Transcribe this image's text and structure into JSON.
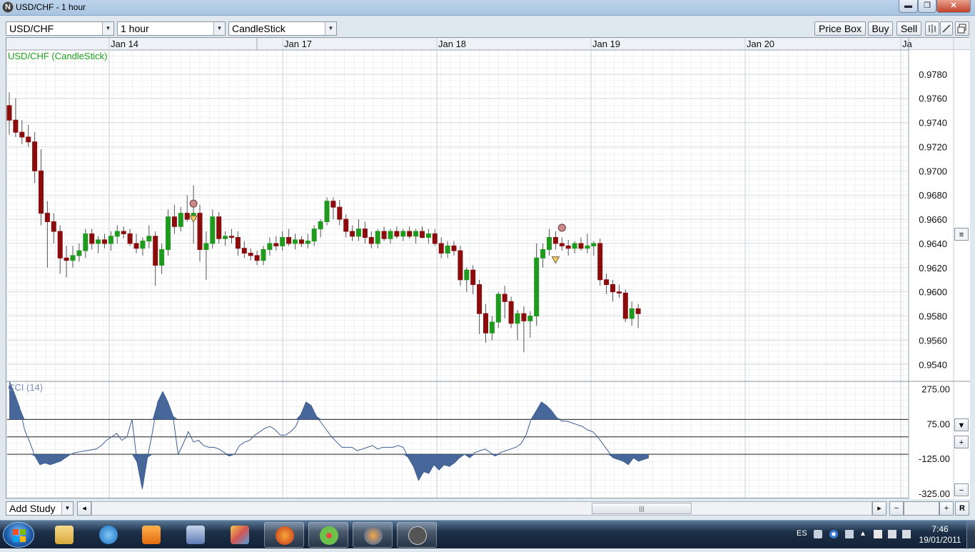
{
  "window": {
    "title": "USD/CHF - 1 hour",
    "minimize": "▬",
    "maximize": "❐",
    "close": "✕"
  },
  "toolbar": {
    "symbol": "USD/CHF",
    "timeframe": "1 hour",
    "chart_type": "CandleStick",
    "price_box": "Price Box",
    "buy": "Buy",
    "sell": "Sell"
  },
  "chart": {
    "legend": "USD/CHF (CandleStick)",
    "indicator_legend": "CCI (14)",
    "colors": {
      "up": "#1f9a1f",
      "down": "#8b0c0c",
      "legend": "#1fa31f",
      "cci": "#3d5f95",
      "cci_legend": "#7d8fb8",
      "grid": "#e6e8ec"
    }
  },
  "chart_data": [
    {
      "type": "candlestick",
      "x_labels": [
        "Jan 14",
        "Jan 17",
        "Jan 18",
        "Jan 19",
        "Jan 20",
        "Ja"
      ],
      "y_ticks": [
        "0.9780",
        "0.9760",
        "0.9740",
        "0.9720",
        "0.9700",
        "0.9680",
        "0.9660",
        "0.9640",
        "0.9620",
        "0.9600",
        "0.9580",
        "0.9560",
        "0.9540"
      ],
      "ylim": [
        0.9526,
        0.98
      ],
      "candles": [
        [
          0.9754,
          0.9765,
          0.973,
          0.9742
        ],
        [
          0.9742,
          0.976,
          0.9728,
          0.9732
        ],
        [
          0.9732,
          0.9742,
          0.9722,
          0.9728
        ],
        [
          0.9728,
          0.9738,
          0.972,
          0.9724
        ],
        [
          0.9724,
          0.9732,
          0.969,
          0.97
        ],
        [
          0.97,
          0.9718,
          0.9655,
          0.9665
        ],
        [
          0.9665,
          0.9675,
          0.962,
          0.9658
        ],
        [
          0.9658,
          0.9665,
          0.964,
          0.965
        ],
        [
          0.965,
          0.9655,
          0.9615,
          0.9628
        ],
        [
          0.9628,
          0.9638,
          0.9612,
          0.9626
        ],
        [
          0.9626,
          0.9638,
          0.962,
          0.963
        ],
        [
          0.963,
          0.964,
          0.9625,
          0.9634
        ],
        [
          0.9634,
          0.9652,
          0.9628,
          0.9648
        ],
        [
          0.9648,
          0.9652,
          0.9635,
          0.964
        ],
        [
          0.964,
          0.9646,
          0.9632,
          0.9643
        ],
        [
          0.9643,
          0.9648,
          0.9636,
          0.964
        ],
        [
          0.964,
          0.965,
          0.9634,
          0.9646
        ],
        [
          0.9646,
          0.9655,
          0.964,
          0.965
        ],
        [
          0.965,
          0.9654,
          0.9644,
          0.9648
        ],
        [
          0.9648,
          0.9652,
          0.9638,
          0.964
        ],
        [
          0.964,
          0.9648,
          0.9632,
          0.9636
        ],
        [
          0.9636,
          0.9645,
          0.963,
          0.9642
        ],
        [
          0.9642,
          0.9655,
          0.9636,
          0.9646
        ],
        [
          0.9646,
          0.965,
          0.9605,
          0.9622
        ],
        [
          0.9622,
          0.964,
          0.9615,
          0.9635
        ],
        [
          0.9635,
          0.9668,
          0.963,
          0.9662
        ],
        [
          0.9662,
          0.9672,
          0.9648,
          0.9654
        ],
        [
          0.9654,
          0.967,
          0.965,
          0.9665
        ],
        [
          0.9665,
          0.968,
          0.9658,
          0.966
        ],
        [
          0.966,
          0.9688,
          0.964,
          0.9665
        ],
        [
          0.9665,
          0.9672,
          0.9625,
          0.9635
        ],
        [
          0.9635,
          0.965,
          0.961,
          0.964
        ],
        [
          0.964,
          0.9668,
          0.9636,
          0.9662
        ],
        [
          0.9662,
          0.9666,
          0.964,
          0.9644
        ],
        [
          0.9644,
          0.965,
          0.9638,
          0.9646
        ],
        [
          0.9646,
          0.9652,
          0.964,
          0.9645
        ],
        [
          0.9645,
          0.965,
          0.963,
          0.9636
        ],
        [
          0.9636,
          0.9642,
          0.9628,
          0.9632
        ],
        [
          0.9632,
          0.9636,
          0.9626,
          0.963
        ],
        [
          0.963,
          0.9634,
          0.9622,
          0.9626
        ],
        [
          0.9626,
          0.9638,
          0.9622,
          0.9635
        ],
        [
          0.9635,
          0.9645,
          0.963,
          0.964
        ],
        [
          0.964,
          0.9646,
          0.9634,
          0.9638
        ],
        [
          0.9638,
          0.965,
          0.9634,
          0.9645
        ],
        [
          0.9645,
          0.9652,
          0.9638,
          0.964
        ],
        [
          0.964,
          0.9648,
          0.9635,
          0.9643
        ],
        [
          0.9643,
          0.9646,
          0.9637,
          0.964
        ],
        [
          0.964,
          0.9648,
          0.9636,
          0.9642
        ],
        [
          0.9642,
          0.9655,
          0.9638,
          0.9652
        ],
        [
          0.9652,
          0.966,
          0.9645,
          0.9658
        ],
        [
          0.9658,
          0.9678,
          0.9655,
          0.9675
        ],
        [
          0.9675,
          0.9678,
          0.966,
          0.967
        ],
        [
          0.967,
          0.9676,
          0.9655,
          0.966
        ],
        [
          0.966,
          0.9664,
          0.9645,
          0.965
        ],
        [
          0.965,
          0.9655,
          0.9642,
          0.9646
        ],
        [
          0.9646,
          0.966,
          0.9642,
          0.9652
        ],
        [
          0.9652,
          0.9658,
          0.964,
          0.9645
        ],
        [
          0.9645,
          0.965,
          0.9636,
          0.964
        ],
        [
          0.964,
          0.9652,
          0.9636,
          0.965
        ],
        [
          0.965,
          0.9654,
          0.9642,
          0.9644
        ],
        [
          0.9644,
          0.9652,
          0.964,
          0.965
        ],
        [
          0.965,
          0.9654,
          0.9644,
          0.9646
        ],
        [
          0.9646,
          0.9652,
          0.9642,
          0.965
        ],
        [
          0.965,
          0.9654,
          0.9644,
          0.9646
        ],
        [
          0.9646,
          0.9652,
          0.964,
          0.965
        ],
        [
          0.965,
          0.9654,
          0.9644,
          0.9645
        ],
        [
          0.9645,
          0.9652,
          0.964,
          0.9648
        ],
        [
          0.9648,
          0.9652,
          0.9638,
          0.964
        ],
        [
          0.964,
          0.9645,
          0.9628,
          0.9632
        ],
        [
          0.9632,
          0.9642,
          0.9628,
          0.9638
        ],
        [
          0.9638,
          0.9642,
          0.963,
          0.9634
        ],
        [
          0.9634,
          0.9638,
          0.9605,
          0.961
        ],
        [
          0.961,
          0.962,
          0.96,
          0.9618
        ],
        [
          0.9618,
          0.9622,
          0.9598,
          0.9606
        ],
        [
          0.9606,
          0.961,
          0.9565,
          0.9582
        ],
        [
          0.9582,
          0.959,
          0.9558,
          0.9566
        ],
        [
          0.9566,
          0.958,
          0.956,
          0.9575
        ],
        [
          0.9575,
          0.96,
          0.957,
          0.9598
        ],
        [
          0.9598,
          0.9605,
          0.9578,
          0.9592
        ],
        [
          0.9592,
          0.9596,
          0.957,
          0.9574
        ],
        [
          0.9574,
          0.9585,
          0.956,
          0.9582
        ],
        [
          0.9582,
          0.9588,
          0.955,
          0.9576
        ],
        [
          0.9576,
          0.9584,
          0.9562,
          0.958
        ],
        [
          0.958,
          0.964,
          0.9572,
          0.9628
        ],
        [
          0.9628,
          0.964,
          0.962,
          0.9635
        ],
        [
          0.9635,
          0.9652,
          0.963,
          0.9645
        ],
        [
          0.9645,
          0.965,
          0.9635,
          0.964
        ],
        [
          0.964,
          0.9645,
          0.9634,
          0.9638
        ],
        [
          0.9638,
          0.9643,
          0.963,
          0.9636
        ],
        [
          0.9636,
          0.9642,
          0.9632,
          0.964
        ],
        [
          0.964,
          0.9645,
          0.9634,
          0.9636
        ],
        [
          0.9636,
          0.9648,
          0.9632,
          0.9638
        ],
        [
          0.9638,
          0.9642,
          0.963,
          0.964
        ],
        [
          0.964,
          0.9644,
          0.9605,
          0.961
        ],
        [
          0.961,
          0.9615,
          0.9598,
          0.9606
        ],
        [
          0.9606,
          0.961,
          0.9592,
          0.96
        ],
        [
          0.96,
          0.9606,
          0.9595,
          0.9599
        ],
        [
          0.9599,
          0.9602,
          0.9575,
          0.9578
        ],
        [
          0.9578,
          0.9592,
          0.9572,
          0.9586
        ],
        [
          0.9586,
          0.959,
          0.957,
          0.9582
        ]
      ],
      "buy_signals": [
        {
          "index": 29,
          "price": 0.966
        },
        {
          "index": 86,
          "price": 0.9626
        }
      ],
      "sell_signals": [
        {
          "index": 29,
          "price": 0.9673
        },
        {
          "index": 87,
          "price": 0.9653
        }
      ]
    },
    {
      "type": "area",
      "title": "CCI (14)",
      "y_ticks": [
        "275.00",
        "75.00",
        "-125.00",
        "-325.00"
      ],
      "ylim": [
        -350,
        315
      ],
      "levels": [
        100,
        0,
        -100
      ],
      "values": [
        320,
        250,
        170,
        40,
        -30,
        -110,
        -160,
        -150,
        -160,
        -150,
        -140,
        -120,
        -100,
        -90,
        -85,
        -80,
        -75,
        -70,
        -50,
        -20,
        0,
        20,
        -20,
        0,
        100,
        -150,
        -300,
        -120,
        30,
        200,
        260,
        200,
        120,
        -100,
        -40,
        30,
        -30,
        -20,
        -50,
        -60,
        -60,
        -70,
        -90,
        -110,
        -100,
        -50,
        -30,
        -20,
        10,
        30,
        50,
        60,
        40,
        10,
        10,
        30,
        60,
        130,
        200,
        180,
        120,
        80,
        40,
        0,
        -30,
        -60,
        -60,
        -60,
        -80,
        -70,
        -60,
        -50,
        -70,
        -60,
        -60,
        -60,
        -50,
        -60,
        -120,
        -170,
        -250,
        -200,
        -210,
        -160,
        -190,
        -160,
        -170,
        -150,
        -120,
        -100,
        -120,
        -90,
        -80,
        -70,
        -90,
        -110,
        -90,
        -80,
        -70,
        -60,
        -40,
        10,
        100,
        150,
        200,
        180,
        150,
        110,
        90,
        90,
        80,
        70,
        60,
        40,
        30,
        0,
        -40,
        -80,
        -120,
        -130,
        -140,
        -160,
        -120,
        -140,
        -130,
        -120
      ],
      "values_order": "left-to-right"
    }
  ],
  "price_scale_buttons": {
    "down": "▼",
    "plus": "+",
    "minus": "−",
    "handle": "≡"
  },
  "statusbar": {
    "add_study": "Add Study",
    "scroll_left": "◂",
    "scroll_right": "▸",
    "thumb": "|||",
    "zoom_minus": "−",
    "zoom_plus": "+",
    "reset": "R"
  },
  "taskbar": {
    "language": "ES",
    "time": "7:46",
    "date": "19/01/2011"
  }
}
